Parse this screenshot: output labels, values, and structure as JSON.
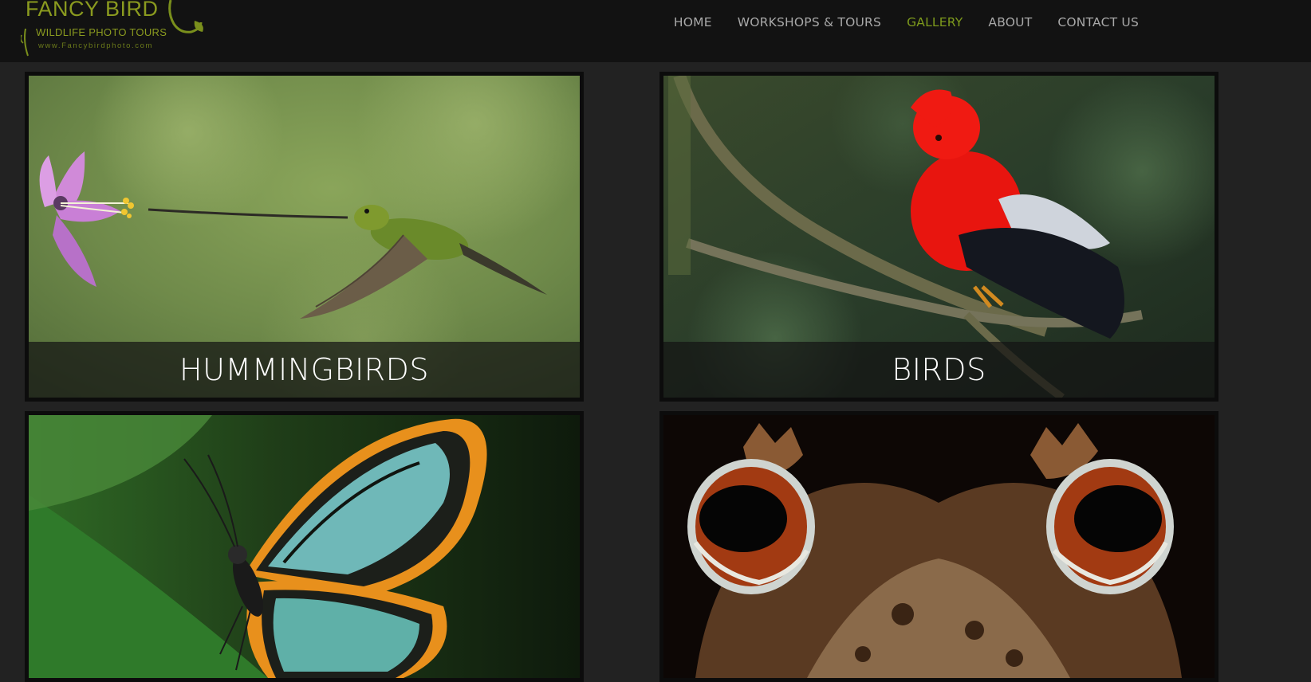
{
  "logo": {
    "title": "FANCY BIRD",
    "subtitle": "WILDLIFE PHOTO TOURS",
    "url": "www.Fancybirdphoto.com"
  },
  "nav": {
    "items": [
      {
        "label": "HOME"
      },
      {
        "label": "WORKSHOPS & TOURS"
      },
      {
        "label": "GALLERY"
      },
      {
        "label": "ABOUT"
      },
      {
        "label": "CONTACT US"
      }
    ],
    "active": "GALLERY"
  },
  "gallery": {
    "tiles": [
      {
        "caption": "HUMMINGBIRDS",
        "icon": "hummingbird-photo"
      },
      {
        "caption": "BIRDS",
        "icon": "cock-of-the-rock-photo"
      },
      {
        "caption": "",
        "icon": "glasswing-butterfly-photo"
      },
      {
        "caption": "",
        "icon": "horned-frog-photo"
      }
    ]
  },
  "colors": {
    "background": "#222222",
    "header": "#121212",
    "brand_green": "#8a9a1f",
    "nav_text": "#a8a8a8",
    "nav_active": "#7d9a1c"
  }
}
